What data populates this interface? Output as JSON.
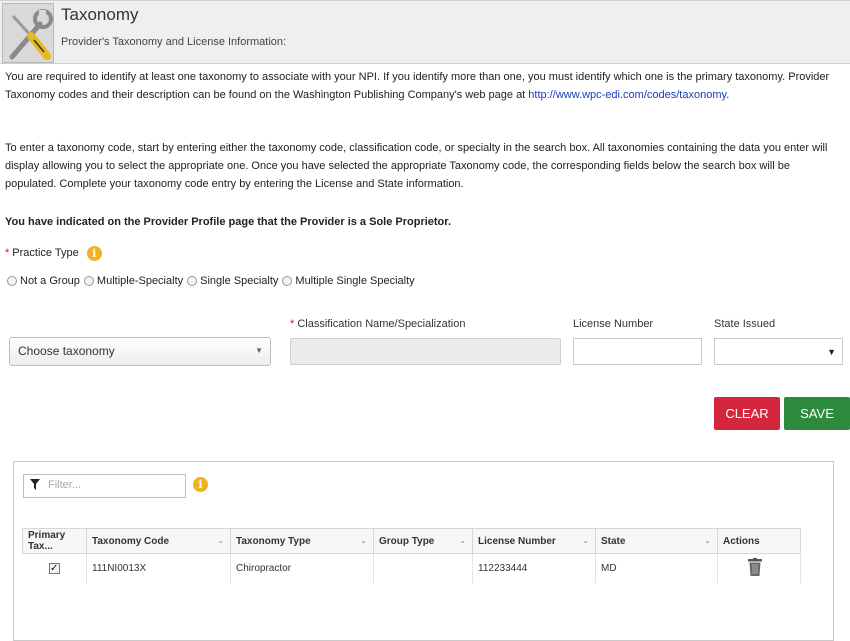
{
  "header": {
    "title": "Taxonomy",
    "subtitle": "Provider's Taxonomy and License Information:",
    "icon": "tools-icon"
  },
  "intro": {
    "p1_text": "You are required to identify at least one taxonomy to associate with your NPI. If you identify more than one, you must identify which one is the primary taxonomy. Provider Taxonomy codes and their description can be found on the Washington Publishing Company's web page at ",
    "p1_link": "http://www.wpc-edi.com/codes/taxonomy",
    "p1_end": ".",
    "p2": "To enter a taxonomy code, start by entering either the taxonomy code, classification code, or specialty in the search box. All taxonomies containing the data you enter will display allowing you to select the appropriate one. Once you have selected the appropriate Taxonomy code, the corresponding fields below the search box will be populated. Complete your taxonomy code entry by entering the License and State information.",
    "p3": "You have indicated on the Provider Profile page that the Provider is a Sole Proprietor."
  },
  "practice_type": {
    "label": "Practice Type",
    "required_mark": "*",
    "options": [
      "Not a Group",
      "Multiple-Specialty",
      "Single Specialty",
      "Multiple Single Specialty"
    ]
  },
  "form": {
    "taxonomy_select": "Choose taxonomy",
    "classification_label": "Classification Name/Specialization",
    "license_label": "License Number",
    "state_label": "State Issued",
    "license_value": "",
    "state_value": ""
  },
  "buttons": {
    "clear": "CLEAR",
    "save": "SAVE"
  },
  "grid": {
    "filter_placeholder": "Filter...",
    "columns": [
      "Primary Tax...",
      "Taxonomy Code",
      "Taxonomy Type",
      "Group Type",
      "License Number",
      "State",
      "Actions"
    ],
    "rows": [
      {
        "primary": true,
        "code": "111NI0013X",
        "type": "Chiropractor",
        "group": "",
        "license": "112233444",
        "state": "MD"
      }
    ]
  },
  "colors": {
    "clear": "#d4263d",
    "save": "#2e8b3e",
    "info": "#f0b320",
    "link": "#1a3bb8"
  }
}
